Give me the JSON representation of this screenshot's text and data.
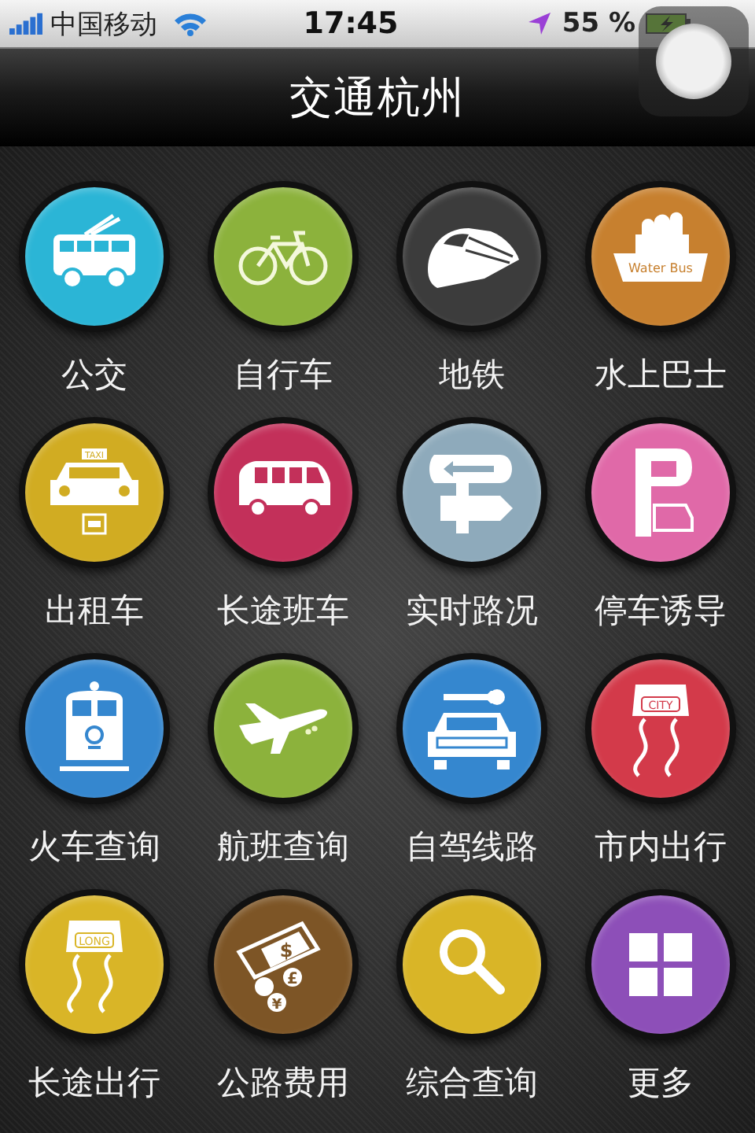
{
  "status_bar": {
    "carrier": "中国移动",
    "time": "17:45",
    "battery": "55 %"
  },
  "nav_bar": {
    "title": "交通杭州"
  },
  "items": [
    {
      "label": "公交",
      "kind": "trolleybus",
      "color": "#2bb5d6"
    },
    {
      "label": "自行车",
      "kind": "bicycle",
      "color": "#8cb23c"
    },
    {
      "label": "地铁",
      "kind": "bullet-train",
      "color": "#3c3c3c"
    },
    {
      "label": "水上巴士",
      "kind": "ferry",
      "color": "#c7802f",
      "icon_texts": [
        "Water Bus"
      ]
    },
    {
      "label": "出租车",
      "kind": "taxi",
      "color": "#d1ac22",
      "icon_texts": [
        "TAXI"
      ]
    },
    {
      "label": "长途班车",
      "kind": "coach",
      "color": "#c3305a"
    },
    {
      "label": "实时路况",
      "kind": "signpost",
      "color": "#8eaabb"
    },
    {
      "label": "停车诱导",
      "kind": "parking",
      "color": "#e069a8"
    },
    {
      "label": "火车查询",
      "kind": "locomotive",
      "color": "#3587cf"
    },
    {
      "label": "航班查询",
      "kind": "plane",
      "color": "#8cb23c"
    },
    {
      "label": "自驾线路",
      "kind": "car-key",
      "color": "#3587cf"
    },
    {
      "label": "市内出行",
      "kind": "road-car",
      "color": "#d33a4a",
      "icon_texts": [
        "CITY"
      ]
    },
    {
      "label": "长途出行",
      "kind": "road-car",
      "color": "#d9b527",
      "icon_texts": [
        "LONG"
      ]
    },
    {
      "label": "公路费用",
      "kind": "money",
      "color": "#7d5526",
      "icon_texts": [
        "$",
        "£",
        "¥"
      ]
    },
    {
      "label": "综合查询",
      "kind": "search",
      "color": "#d9b527"
    },
    {
      "label": "更多",
      "kind": "grid",
      "color": "#8d4fb8"
    }
  ]
}
